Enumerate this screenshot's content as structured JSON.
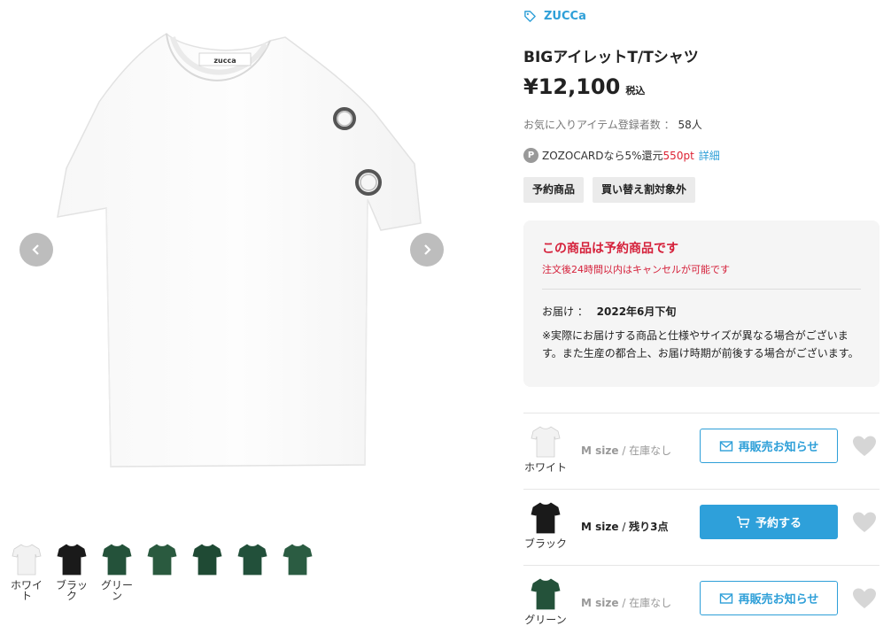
{
  "brand": {
    "name": "ZUCCa",
    "icon": "tag-icon"
  },
  "product": {
    "title": "BIGアイレットT/Tシャツ",
    "price": "¥12,100",
    "tax_label": "税込"
  },
  "favorites": {
    "label": "お気に入りアイテム登録者数 ：",
    "count": "58人"
  },
  "zozocard": {
    "badge": "P",
    "text": "ZOZOCARDなら5%還元",
    "points": "550pt",
    "detail": "詳細"
  },
  "tags": [
    "予約商品",
    "買い替え割対象外"
  ],
  "preorder": {
    "title": "この商品は予約商品です",
    "subtitle": "注文後24時間以内はキャンセルが可能です",
    "delivery_label": "お届け ：",
    "delivery_date": "2022年6月下旬",
    "note": "※実際にお届けする商品と仕様やサイズが異なる場合がございます。また生産の都合上、お届け時期が前後する場合がございます。"
  },
  "gallery": {
    "main_logo_text": "zucca",
    "thumbs": [
      {
        "label": "ホワイト",
        "color": "#f2f2f2"
      },
      {
        "label": "ブラック",
        "color": "#1a1a1a"
      },
      {
        "label": "グリーン",
        "color": "#24523a"
      },
      {
        "label": "",
        "color": "#2a5a3f"
      },
      {
        "label": "",
        "color": "#1f4a34"
      },
      {
        "label": "",
        "color": "#22503a"
      },
      {
        "label": "",
        "color": "#2b5c42"
      }
    ]
  },
  "variants": [
    {
      "color_name": "ホワイト",
      "color": "#f2f2f2",
      "size": "M size",
      "stock": "在庫なし",
      "available": false,
      "button": "再販売お知らせ",
      "button_icon": "mail-icon"
    },
    {
      "color_name": "ブラック",
      "color": "#1a1a1a",
      "size": "M size",
      "stock": "残り3点",
      "available": true,
      "button": "予約する",
      "button_icon": "cart-icon"
    },
    {
      "color_name": "グリーン",
      "color": "#24523a",
      "size": "M size",
      "stock": "在庫なし",
      "available": false,
      "button": "再販売お知らせ",
      "button_icon": "mail-icon"
    }
  ],
  "colors": {
    "accent": "#2e9fd8",
    "alert": "#d5203a",
    "box_bg": "#f5f5f5"
  }
}
